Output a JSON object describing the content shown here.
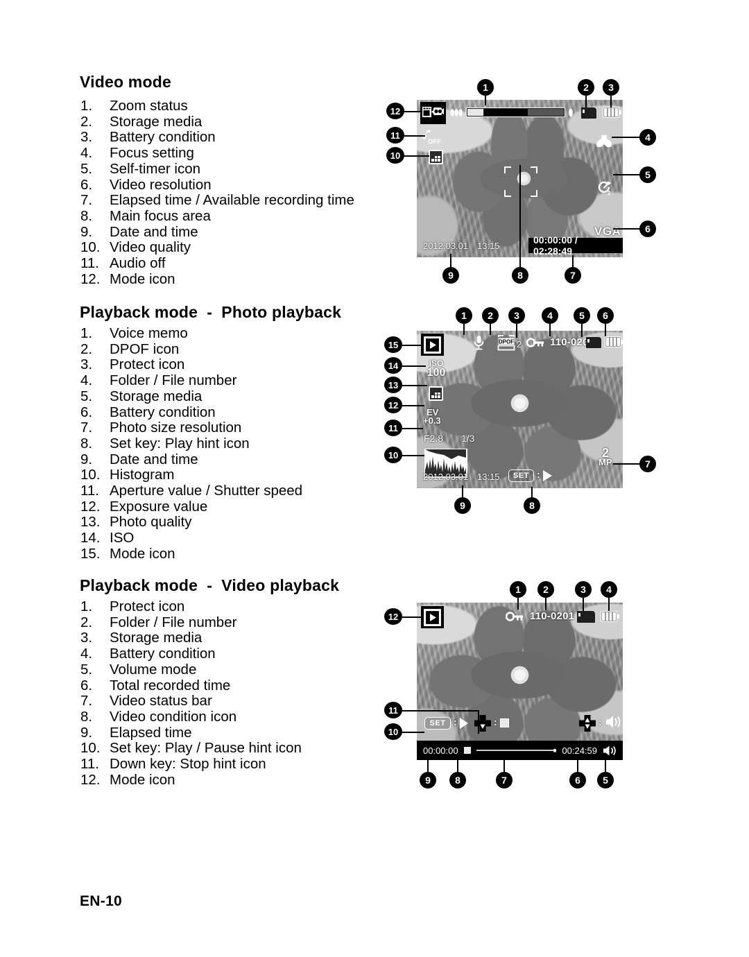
{
  "page": {
    "page_number": "EN-10"
  },
  "sections": [
    {
      "id": "video-mode",
      "heading": "Video mode",
      "items": [
        {
          "num": "1.",
          "label": "Zoom status"
        },
        {
          "num": "2.",
          "label": "Storage media"
        },
        {
          "num": "3.",
          "label": "Battery condition"
        },
        {
          "num": "4.",
          "label": "Focus setting"
        },
        {
          "num": "5.",
          "label": "Self-timer icon"
        },
        {
          "num": "6.",
          "label": "Video resolution"
        },
        {
          "num": "7.",
          "label": "Elapsed time / Available recording time"
        },
        {
          "num": "8.",
          "label": "Main focus area"
        },
        {
          "num": "9.",
          "label": "Date and time"
        },
        {
          "num": "10.",
          "label": "Video quality"
        },
        {
          "num": "11.",
          "label": "Audio off"
        },
        {
          "num": "12.",
          "label": "Mode icon"
        }
      ]
    },
    {
      "id": "photo-playback",
      "heading": "Playback mode  -  Photo playback",
      "items": [
        {
          "num": "1.",
          "label": "Voice memo"
        },
        {
          "num": "2.",
          "label": "DPOF icon"
        },
        {
          "num": "3.",
          "label": "Protect icon"
        },
        {
          "num": "4.",
          "label": "Folder / File number"
        },
        {
          "num": "5.",
          "label": "Storage media"
        },
        {
          "num": "6.",
          "label": "Battery condition"
        },
        {
          "num": "7.",
          "label": "Photo size resolution"
        },
        {
          "num": "8.",
          "label": "Set key: Play hint icon"
        },
        {
          "num": "9.",
          "label": "Date and time"
        },
        {
          "num": "10.",
          "label": "Histogram"
        },
        {
          "num": "11.",
          "label": "Aperture value / Shutter speed"
        },
        {
          "num": "12.",
          "label": "Exposure value"
        },
        {
          "num": "13.",
          "label": "Photo quality"
        },
        {
          "num": "14.",
          "label": "ISO"
        },
        {
          "num": "15.",
          "label": "Mode icon"
        }
      ]
    },
    {
      "id": "video-playback",
      "heading": "Playback mode  -  Video playback",
      "items": [
        {
          "num": "1.",
          "label": "Protect icon"
        },
        {
          "num": "2.",
          "label": "Folder / File number"
        },
        {
          "num": "3.",
          "label": "Storage media"
        },
        {
          "num": "4.",
          "label": "Battery condition"
        },
        {
          "num": "5.",
          "label": "Volume mode"
        },
        {
          "num": "6.",
          "label": "Total recorded time"
        },
        {
          "num": "7.",
          "label": "Video status bar"
        },
        {
          "num": "8.",
          "label": "Video condition icon"
        },
        {
          "num": "9.",
          "label": "Elapsed time"
        },
        {
          "num": "10.",
          "label": "Set key: Play / Pause hint icon"
        },
        {
          "num": "11.",
          "label": "Down key: Stop hint icon"
        },
        {
          "num": "12.",
          "label": "Mode icon"
        }
      ]
    }
  ],
  "screens": {
    "video_mode": {
      "callouts": [
        "1",
        "2",
        "3",
        "4",
        "5",
        "6",
        "7",
        "8",
        "9",
        "10",
        "11",
        "12"
      ],
      "osd": {
        "date": "2012.03.01",
        "time": "13:15",
        "elapsed_available": "00:00:00 / 02:28:49",
        "resolution": "VGA",
        "audio_off_label": "OFF",
        "mode_icon": "video-camera-icon",
        "storage_icon": "sd-card-icon",
        "battery_icon": "battery-full-icon",
        "focus_icon": "macro-flower-icon",
        "selftimer_icon": "self-timer-icon",
        "quality_icon": "video-quality-icon",
        "zoom_wide_icon": "zoom-wide-icon",
        "zoom_tele_icon": "zoom-tele-icon",
        "focus_area_icon": "main-focus-area-brackets"
      }
    },
    "photo_playback": {
      "callouts": [
        "1",
        "2",
        "3",
        "4",
        "5",
        "6",
        "7",
        "8",
        "9",
        "10",
        "11",
        "12",
        "13",
        "14",
        "15"
      ],
      "osd": {
        "dpof_label": "DPOF",
        "dpof_count": "2",
        "folder_file": "110-0201",
        "iso_label": "ISO",
        "iso_value": "100",
        "ev_label": "EV",
        "ev_value": "+0.3",
        "aperture": "F2.8",
        "shutter": "1/3",
        "date": "2012.03.01",
        "time": "13:15",
        "set_label": "SET",
        "photo_size": "2",
        "photo_size_unit": "MP",
        "mode_icon": "playback-icon",
        "voice_memo_icon": "microphone-icon",
        "protect_icon": "key-lock-icon",
        "storage_icon": "sd-card-icon",
        "battery_icon": "battery-full-icon",
        "quality_icon": "photo-quality-icon",
        "histogram_icon": "histogram-graph"
      }
    },
    "video_playback": {
      "callouts": [
        "1",
        "2",
        "3",
        "4",
        "5",
        "6",
        "7",
        "8",
        "9",
        "10",
        "11",
        "12"
      ],
      "osd": {
        "folder_file": "110-0201",
        "set_label": "SET",
        "elapsed": "00:00:00",
        "total": "00:24:59",
        "mode_icon": "playback-icon",
        "protect_icon": "key-lock-icon",
        "storage_icon": "sd-card-icon",
        "battery_icon": "battery-full-icon",
        "play_hint_icon": "play-triangle-icon",
        "stop_hint_icon": "stop-square-icon",
        "down_key_icon": "dpad-down-icon",
        "volume_key_icon": "dpad-updown-icon",
        "volume_icon": "speaker-icon",
        "status_bar_icon": "video-status-bar",
        "condition_icon": "stop-square-indicator"
      }
    }
  },
  "colors": {
    "page_bg": "#ffffff",
    "text": "#000000",
    "osd_white": "#ffffff",
    "osd_black": "#000000"
  }
}
